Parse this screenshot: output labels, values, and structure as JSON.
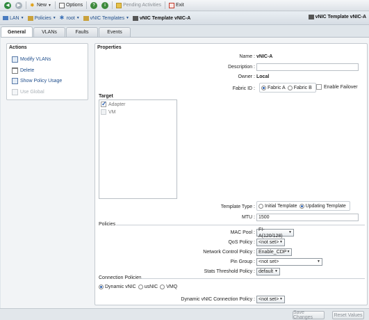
{
  "toolbar": {
    "new_label": "New",
    "options_label": "Options",
    "pending_label": "Pending Activities",
    "exit_label": "Exit"
  },
  "breadcrumb": {
    "items": [
      "LAN",
      "Policies",
      "root",
      "vNIC Templates"
    ],
    "current": "vNIC Template vNIC-A",
    "right_title": "vNIC Template vNIC-A"
  },
  "tabs": [
    "General",
    "VLANs",
    "Faults",
    "Events"
  ],
  "actions": {
    "title": "Actions",
    "items": [
      "Modify VLANs",
      "Delete",
      "Show Policy Usage",
      "Use Global"
    ]
  },
  "properties": {
    "title": "Properties",
    "name_label": "Name",
    "name_value": "vNIC-A",
    "description_label": "Description",
    "description_value": "",
    "owner_label": "Owner",
    "owner_value": "Local",
    "fabric_label": "Fabric ID",
    "fabric_options": [
      "Fabric A",
      "Fabric B"
    ],
    "fabric_selected": "Fabric A",
    "failover_label": "Enable Failover",
    "target_label": "Target",
    "target_items": [
      "Adapter",
      "VM"
    ],
    "template_type_label": "Template Type",
    "template_type_options": [
      "Initial Template",
      "Updating Template"
    ],
    "template_type_selected": "Updating Template",
    "mtu_label": "MTU",
    "mtu_value": "1500"
  },
  "policies": {
    "title": "Policies",
    "mac_pool_label": "MAC Pool",
    "mac_pool_value": "FI-A(120/128)",
    "qos_label": "QoS Policy",
    "qos_value": "<not set>",
    "ncp_label": "Network Control Policy",
    "ncp_value": "Enable_CDP",
    "pin_group_label": "Pin Group",
    "pin_group_value": "<not set>",
    "stats_label": "Stats Threshold Policy",
    "stats_value": "default"
  },
  "connection": {
    "title": "Connection Policies",
    "options": [
      "Dynamic vNIC",
      "usNIC",
      "VMQ"
    ],
    "selected": "Dynamic vNIC",
    "dyn_label": "Dynamic vNIC Connection Policy",
    "dyn_value": "<not set>"
  },
  "buttons": {
    "save": "Save Changes",
    "reset": "Reset Values"
  },
  "colors": {
    "link": "#1f4e8c",
    "accent_radio": "#2a5fb0"
  }
}
